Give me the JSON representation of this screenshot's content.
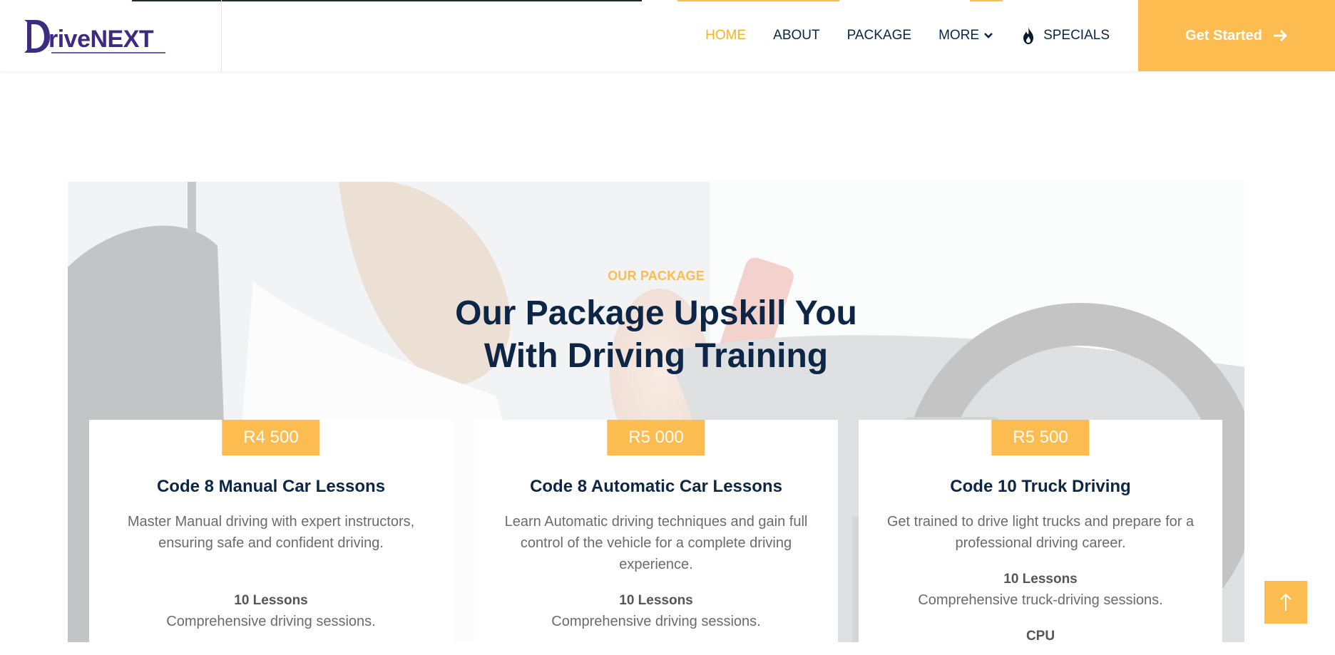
{
  "header": {
    "logo": {
      "text": "riveNEXT",
      "letter_d": "D"
    },
    "nav": [
      {
        "label": "HOME",
        "active": true
      },
      {
        "label": "ABOUT"
      },
      {
        "label": "PACKAGE"
      },
      {
        "label": "MORE"
      },
      {
        "label": "SPECIALS"
      }
    ],
    "cta_label": "Get Started"
  },
  "hero": {
    "eyebrow": "OUR PACKAGE",
    "headline_line1": "Our Package Upskill You",
    "headline_line2": "With Driving Training"
  },
  "packages": [
    {
      "price": "R4 500",
      "title": "Code 8 Manual Car Lessons",
      "description": "Master Manual driving with expert instructors, ensuring safe and confident driving.",
      "lessons": "10 Lessons",
      "sessions": "Comprehensive driving sessions."
    },
    {
      "price": "R5 000",
      "title": "Code 8 Automatic Car Lessons",
      "description": "Learn Automatic driving techniques and gain full control of the vehicle for a complete driving experience.",
      "lessons": "10 Lessons",
      "sessions": "Comprehensive driving sessions."
    },
    {
      "price": "R5 500",
      "title": "Code 10 Truck Driving",
      "description": "Get trained to drive light trucks and prepare for a professional driving career.",
      "lessons": "10 Lessons",
      "sessions": "Comprehensive truck-driving sessions.",
      "extra": "CPU"
    }
  ],
  "colors": {
    "accent": "#fdbc4f",
    "nav_active": "#f6b51e",
    "heading": "#0d2645",
    "logo": "#3b2b82"
  },
  "icons": {
    "dropdown": "chevron-down-icon",
    "specials": "fire-icon",
    "cta": "arrow-right-icon",
    "scroll_top": "arrow-up-icon"
  }
}
